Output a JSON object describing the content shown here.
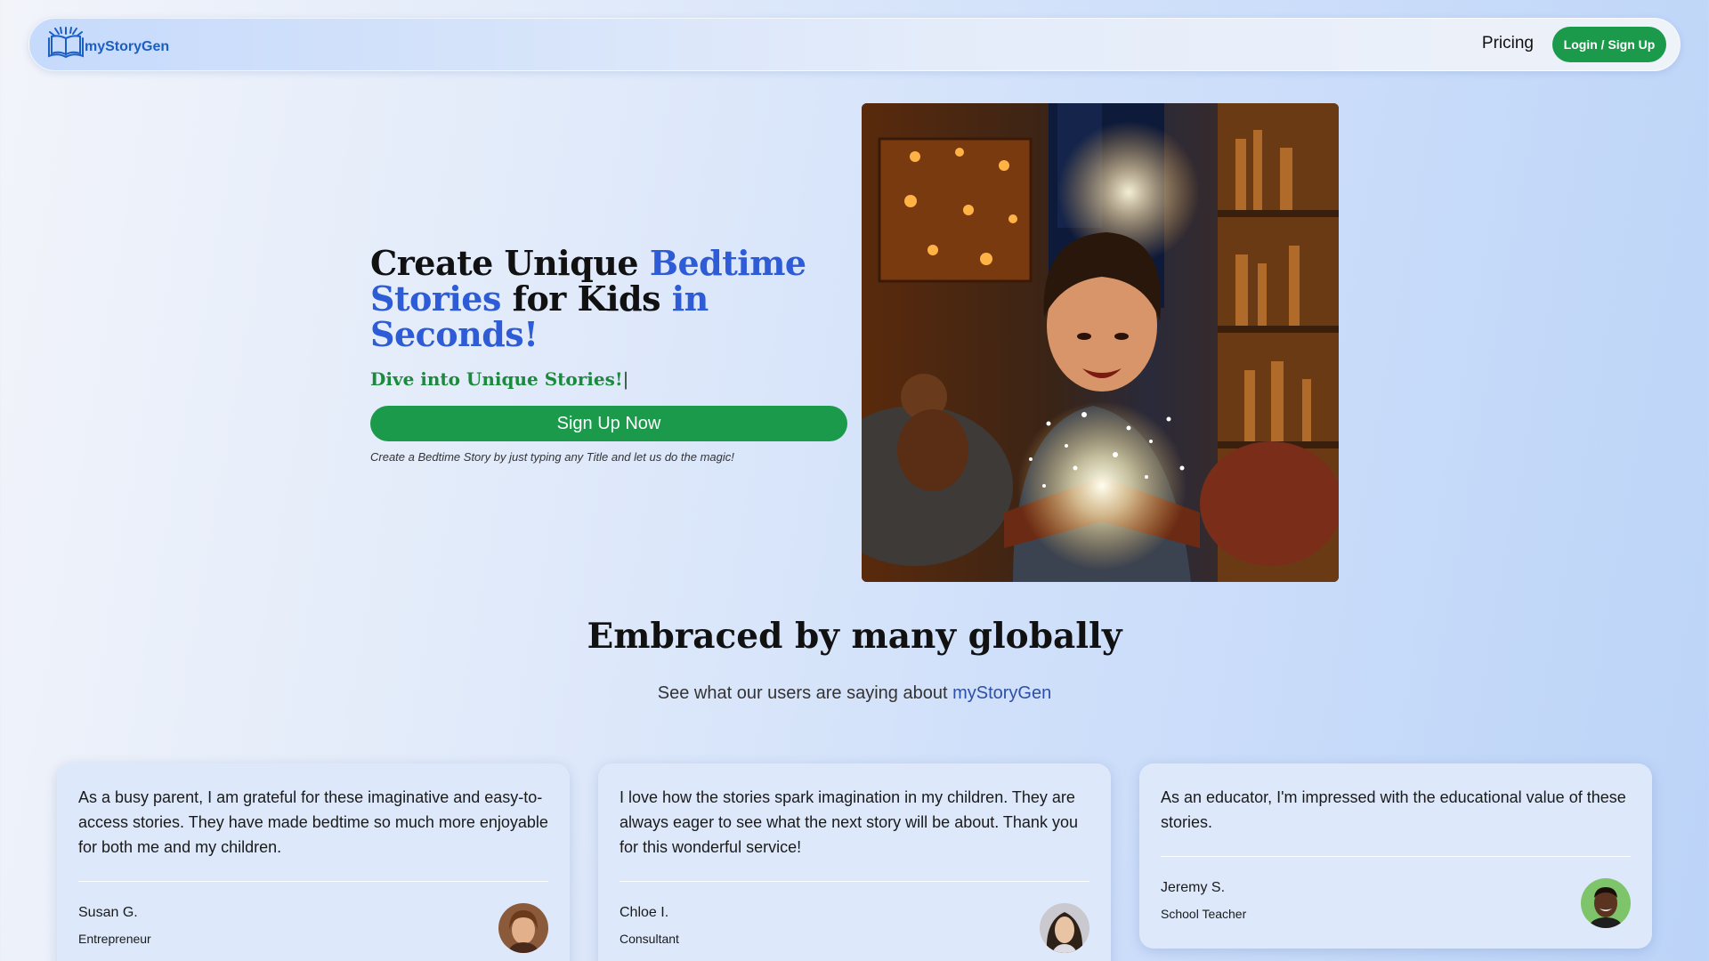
{
  "nav": {
    "brand": "myStoryGen",
    "pricing_label": "Pricing",
    "login_label": "Login / Sign Up"
  },
  "hero": {
    "title_part1": "Create Unique ",
    "title_accent1": "Bedtime Stories",
    "title_part2": " for Kids ",
    "title_accent2": "in Seconds!",
    "subtitle": "Dive into Unique Stories!",
    "cursor": "|",
    "cta_label": "Sign Up Now",
    "note": "Create a Bedtime Story by just typing any Title and let us do the magic!"
  },
  "social_proof": {
    "title": "Embraced by many globally",
    "subtitle_prefix": "See what our users are saying about ",
    "subtitle_brand": "myStoryGen"
  },
  "testimonials": [
    {
      "quote": "As a busy parent, I am grateful for these imaginative and easy-to-access stories. They have made bedtime so much more enjoyable for both me and my children.",
      "name": "Susan G.",
      "role": "Entrepreneur"
    },
    {
      "quote": "I love how the stories spark imagination in my children. They are always eager to see what the next story will be about. Thank you for this wonderful service!",
      "name": "Chloe I.",
      "role": "Consultant"
    },
    {
      "quote": "As an educator, I'm impressed with the educational value of these stories.",
      "name": "Jeremy S.",
      "role": "School Teacher"
    }
  ],
  "colors": {
    "accent_blue": "#2d5cd6",
    "brand_green": "#1a9a4a",
    "subtitle_green": "#1a8a3c"
  },
  "icons": {
    "logo": "open-book-icon"
  }
}
